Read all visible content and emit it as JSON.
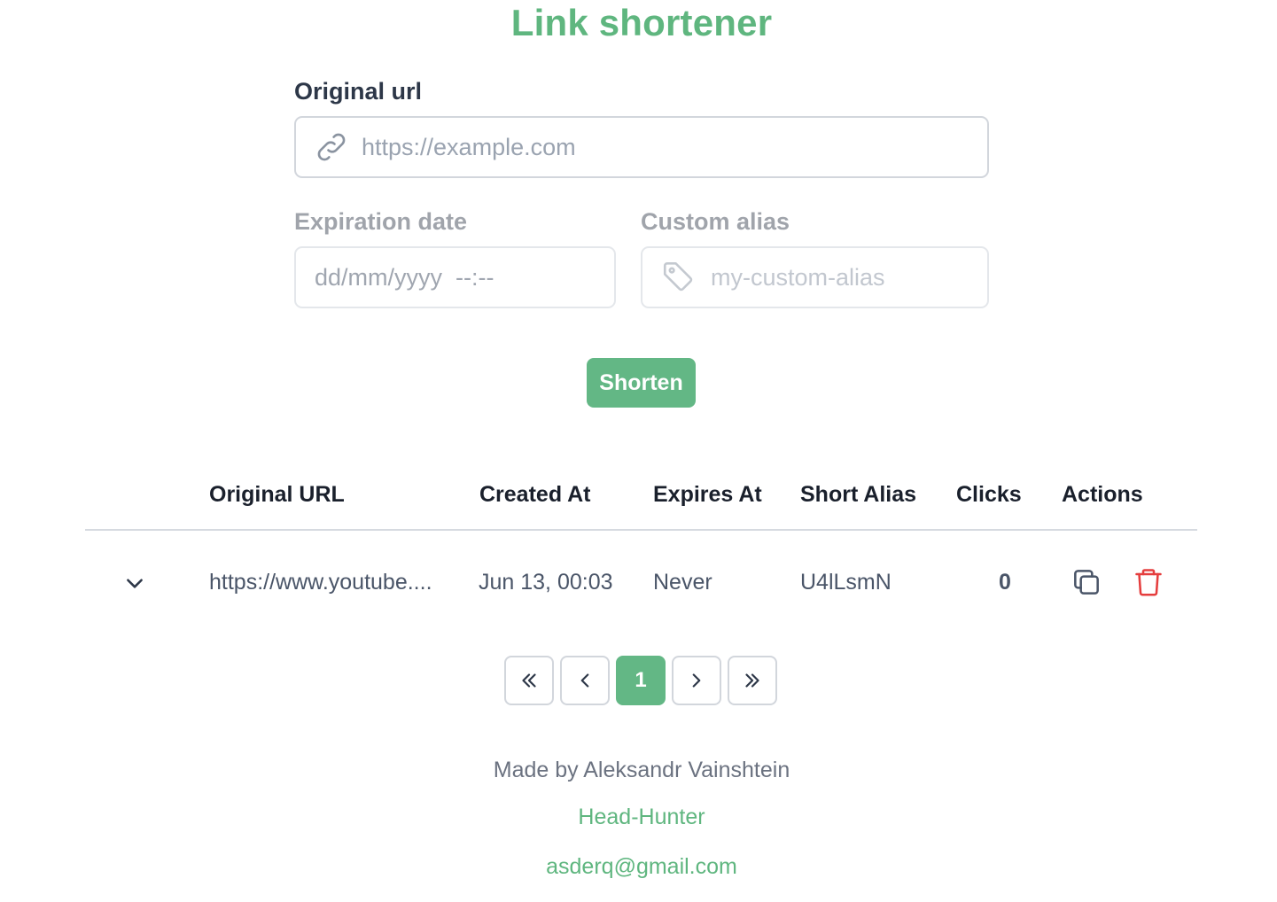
{
  "header": {
    "title": "Link shortener"
  },
  "form": {
    "original_url": {
      "label": "Original url",
      "placeholder": "https://example.com"
    },
    "expiration": {
      "label": "Expiration date",
      "placeholder": "dd/mm/yyyy  --:--"
    },
    "alias": {
      "label": "Custom alias",
      "placeholder": "my-custom-alias"
    },
    "submit_label": "Shorten"
  },
  "table": {
    "headers": [
      "Original URL",
      "Created At",
      "Expires At",
      "Short Alias",
      "Clicks",
      "Actions"
    ],
    "rows": [
      {
        "url": "https://www.youtube....",
        "created": "Jun 13, 00:03",
        "expires": "Never",
        "alias": "U4lLsmN",
        "clicks": "0"
      }
    ]
  },
  "pagination": {
    "current_page": "1"
  },
  "footer": {
    "made_by": "Made by Aleksandr Vainshtein",
    "link_1": "Head-Hunter",
    "link_2": "asderq@gmail.com"
  },
  "colors": {
    "accent": "#63b785",
    "delete": "#e53e3e"
  }
}
